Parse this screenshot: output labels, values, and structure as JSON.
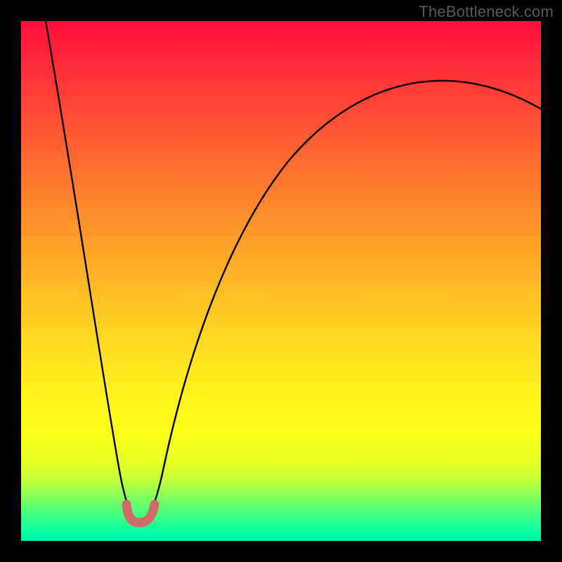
{
  "watermark": "TheBottleneck.com",
  "colors": {
    "gradient_top": "#ff0d3f",
    "gradient_mid": "#ffe120",
    "gradient_bottom": "#00f2b0",
    "curve": "#000000",
    "trough_marker": "#cf6b69",
    "frame_border": "#000000"
  },
  "chart_data": {
    "type": "line",
    "title": "",
    "xlabel": "",
    "ylabel": "",
    "note": "No axis ticks or labels are rendered; x an y are expressed in percent of the visible plot area (0–100). The background encodes value by color from red (high/bad) at top to green (low/good) at bottom. The black curve's minimum (trough) near x≈23 is highlighted.",
    "xlim": [
      0,
      100
    ],
    "ylim": [
      0,
      100
    ],
    "series": [
      {
        "name": "bottleneck-curve",
        "color": "#000000",
        "x": [
          5,
          8,
          11,
          14,
          17,
          19,
          21,
          23,
          25,
          27,
          30,
          34,
          38,
          44,
          52,
          60,
          70,
          80,
          90,
          100
        ],
        "y": [
          100,
          85,
          70,
          55,
          40,
          25,
          12,
          4,
          4,
          12,
          27,
          43,
          55,
          66,
          75,
          81,
          85,
          86,
          85,
          83
        ]
      }
    ],
    "annotations": [
      {
        "name": "optimal-zone",
        "shape": "u-marker",
        "color": "#cf6b69",
        "x_range": [
          20,
          26
        ],
        "y": 4
      }
    ],
    "background_scale": {
      "orientation": "vertical",
      "meaning": "color maps to y (lower y = greener = better)",
      "stops": [
        {
          "pos": 0.0,
          "color": "#ff0d3f"
        },
        {
          "pos": 0.5,
          "color": "#ffe120"
        },
        {
          "pos": 0.85,
          "color": "#e6ff24"
        },
        {
          "pos": 1.0,
          "color": "#00f2b0"
        }
      ]
    }
  }
}
